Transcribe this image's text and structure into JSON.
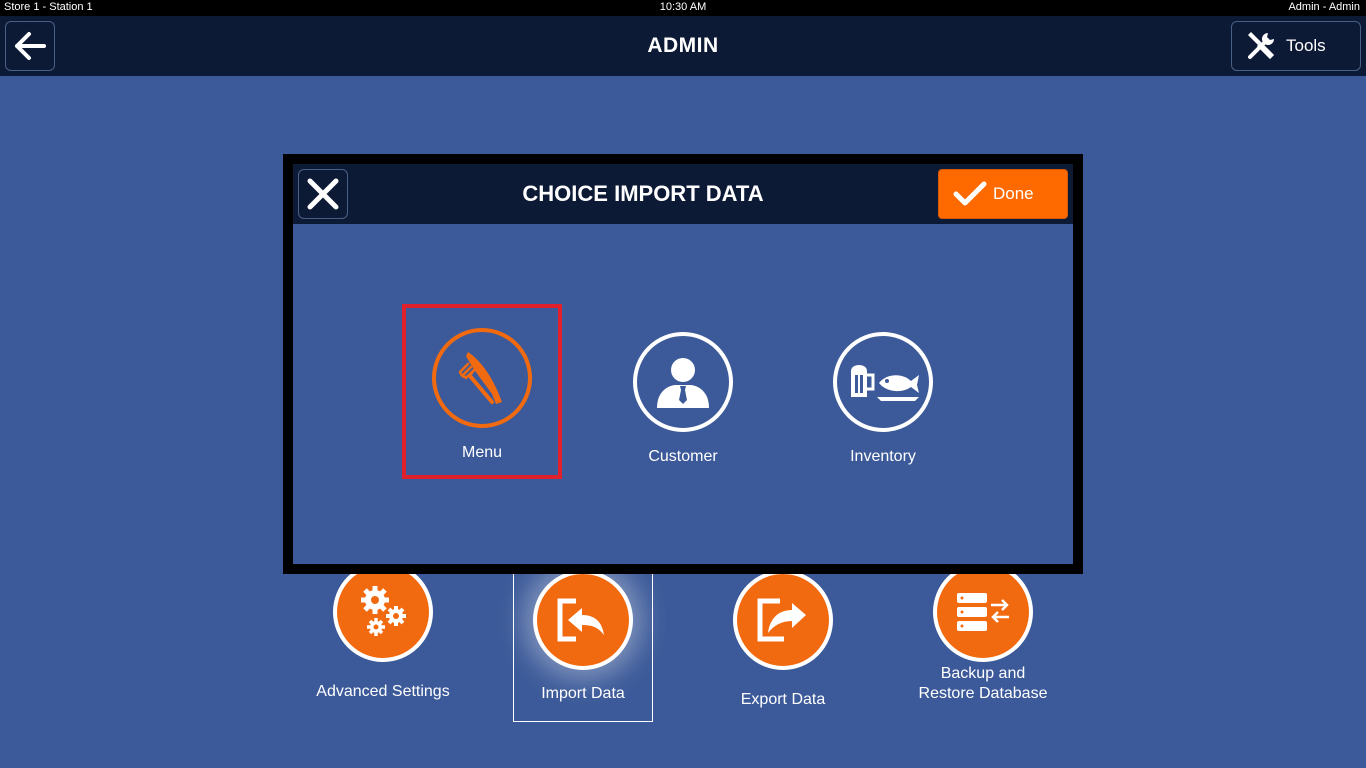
{
  "status_bar": {
    "left": "Store 1 - Station 1",
    "time": "10:30 AM",
    "user": "Admin - Admin"
  },
  "header": {
    "title": "ADMIN",
    "back_icon": "arrow-left-icon",
    "tools_label": "Tools",
    "tools_icon": "tools-icon"
  },
  "admin_tiles": [
    {
      "label": "Advanced Settings",
      "icon": "gears-icon"
    },
    {
      "label": "Import Data",
      "icon": "import-icon"
    },
    {
      "label": "Export Data",
      "icon": "export-icon"
    },
    {
      "label": "Backup and Restore Database",
      "icon": "database-sync-icon"
    }
  ],
  "modal": {
    "title": "CHOICE IMPORT DATA",
    "close_icon": "close-icon",
    "done_label": "Done",
    "done_icon": "checkmark-icon",
    "choices": [
      {
        "label": "Menu",
        "icon": "fork-knife-icon",
        "selected": true
      },
      {
        "label": "Customer",
        "icon": "person-icon",
        "selected": false
      },
      {
        "label": "Inventory",
        "icon": "beer-fish-icon",
        "selected": false
      }
    ]
  },
  "colors": {
    "background": "#3c5a99",
    "header": "#0d1a36",
    "accent": "#ff6a00",
    "selection": "#e0202a"
  }
}
